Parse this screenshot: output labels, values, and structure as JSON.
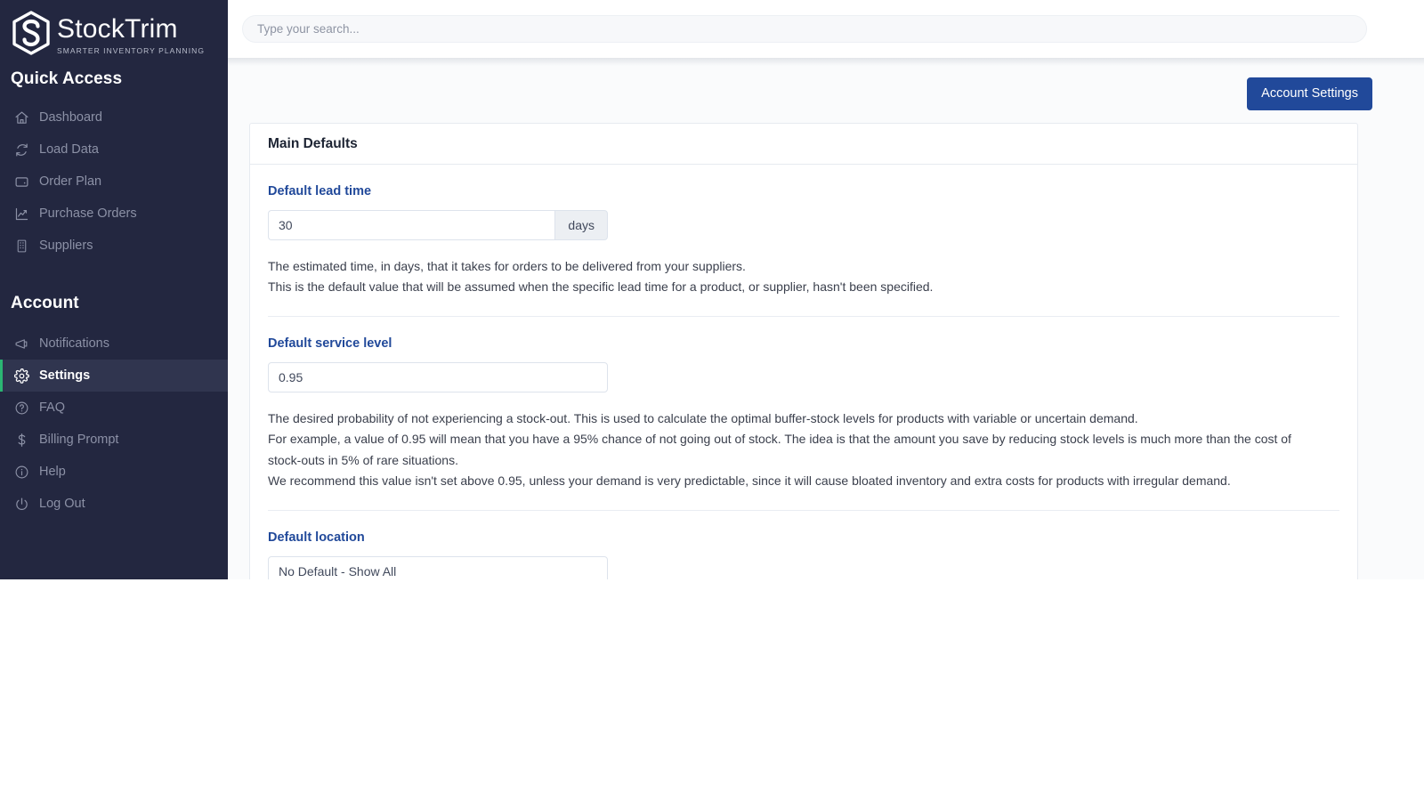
{
  "brand": {
    "name": "StockTrim",
    "tagline": "SMARTER INVENTORY PLANNING",
    "logo_icon": "stocktrim-hexagon-s-logo",
    "accent_active": "#2bb673",
    "sidebar_bg": "#232740",
    "primary_blue": "#21499a"
  },
  "sidebar": {
    "groups": [
      {
        "heading": "Quick Access",
        "items": [
          {
            "label": "Dashboard",
            "icon": "home-icon",
            "active": false
          },
          {
            "label": "Load Data",
            "icon": "refresh-icon",
            "active": false
          },
          {
            "label": "Order Plan",
            "icon": "wallet-icon",
            "active": false
          },
          {
            "label": "Purchase Orders",
            "icon": "chart-line-icon",
            "active": false
          },
          {
            "label": "Suppliers",
            "icon": "building-icon",
            "active": false
          }
        ]
      },
      {
        "heading": "Account",
        "items": [
          {
            "label": "Notifications",
            "icon": "megaphone-icon",
            "active": false
          },
          {
            "label": "Settings",
            "icon": "gear-icon",
            "active": true
          },
          {
            "label": "FAQ",
            "icon": "question-icon",
            "active": false
          },
          {
            "label": "Billing Prompt",
            "icon": "dollar-icon",
            "active": false
          },
          {
            "label": "Help",
            "icon": "info-icon",
            "active": false
          },
          {
            "label": "Log Out",
            "icon": "power-icon",
            "active": false
          }
        ]
      }
    ]
  },
  "header": {
    "search_placeholder": "Type your search...",
    "search_value": ""
  },
  "toolbar": {
    "account_settings_label": "Account Settings"
  },
  "main": {
    "card_title": "Main Defaults",
    "fields": [
      {
        "label": "Default lead time",
        "value": "30",
        "addon": "days",
        "help": [
          "The estimated time, in days, that it takes for orders to be delivered from your suppliers.",
          "This is the default value that will be assumed when the specific lead time for a product, or supplier, hasn't been specified."
        ]
      },
      {
        "label": "Default service level",
        "value": "0.95",
        "addon": "",
        "help": [
          "The desired probability of not experiencing a stock-out. This is used to calculate the optimal buffer-stock levels for products with variable or uncertain demand.",
          "For example, a value of 0.95 will mean that you have a 95% chance of not going out of stock. The idea is that the amount you save by reducing stock levels is much more than the cost of stock-outs in 5% of rare situations.",
          "We recommend this value isn't set above 0.95, unless your demand is very predictable, since it will cause bloated inventory and extra costs for products with irregular demand."
        ]
      },
      {
        "label": "Default location",
        "value": "No Default - Show All",
        "addon": "",
        "help": []
      }
    ]
  }
}
